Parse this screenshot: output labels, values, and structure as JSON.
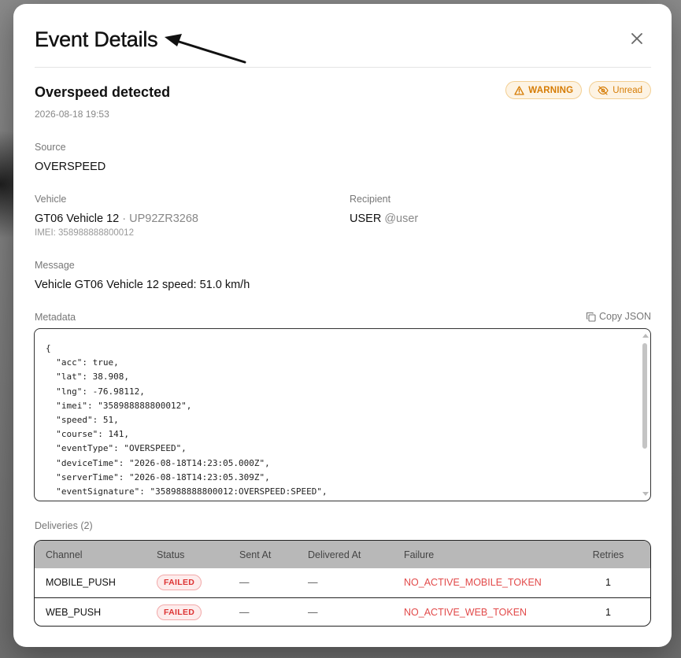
{
  "modal": {
    "title": "Event Details"
  },
  "event": {
    "title": "Overspeed detected",
    "timestamp": "2026-08-18 19:53",
    "badges": [
      {
        "label": "WARNING",
        "icon": "warning-triangle-icon"
      },
      {
        "label": "Unread",
        "icon": "eye-off-icon"
      }
    ]
  },
  "source": {
    "label": "Source",
    "value": "OVERSPEED"
  },
  "vehicle": {
    "label": "Vehicle",
    "name": "GT06 Vehicle 12",
    "separator": " · ",
    "plate": "UP92ZR3268",
    "imei": "IMEI: 358988888800012"
  },
  "recipient": {
    "label": "Recipient",
    "type": "USER",
    "handle": "@user"
  },
  "message": {
    "label": "Message",
    "value": "Vehicle GT06 Vehicle 12 speed: 51.0 km/h"
  },
  "metadata": {
    "label": "Metadata",
    "copy_label": "Copy JSON",
    "json_text": "{\n  \"acc\": true,\n  \"lat\": 38.908,\n  \"lng\": -76.98112,\n  \"imei\": \"358988888800012\",\n  \"speed\": 51,\n  \"course\": 141,\n  \"eventType\": \"OVERSPEED\",\n  \"deviceTime\": \"2026-08-18T14:23:05.000Z\",\n  \"serverTime\": \"2026-08-18T14:23:05.309Z\",\n  \"eventSignature\": \"358988888800012:OVERSPEED:SPEED\","
  },
  "deliveries": {
    "label": "Deliveries (2)",
    "columns": [
      "Channel",
      "Status",
      "Sent At",
      "Delivered At",
      "Failure",
      "Retries"
    ],
    "rows": [
      {
        "channel": "MOBILE_PUSH",
        "status": "FAILED",
        "sent_at": "—",
        "delivered_at": "—",
        "failure": "NO_ACTIVE_MOBILE_TOKEN",
        "retries": "1"
      },
      {
        "channel": "WEB_PUSH",
        "status": "FAILED",
        "sent_at": "—",
        "delivered_at": "—",
        "failure": "NO_ACTIVE_WEB_TOKEN",
        "retries": "1"
      }
    ]
  },
  "colors": {
    "warning_accent": "#d67c05",
    "failed_accent": "#e24a4a"
  }
}
